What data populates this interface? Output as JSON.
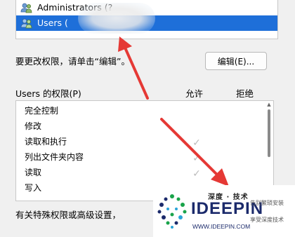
{
  "principals": [
    {
      "name": "Administrators (?",
      "selected": false
    },
    {
      "name": "Users (",
      "selected": true
    }
  ],
  "instruction": "要更改权限，请单击“编辑”。",
  "edit_button_label": "编辑(E)...",
  "permissions_header": {
    "title": "Users 的权限(P)",
    "allow": "允许",
    "deny": "拒绝"
  },
  "permissions": [
    {
      "label": "完全控制",
      "allow": false
    },
    {
      "label": "修改",
      "allow": false
    },
    {
      "label": "读取和执行",
      "allow": true
    },
    {
      "label": "列出文件夹内容",
      "allow": true
    },
    {
      "label": "读取",
      "allow": true
    },
    {
      "label": "写入",
      "allow": false
    }
  ],
  "special_text": "有关特殊权限或高级设置，",
  "watermark": {
    "top": "深度 · 技术",
    "brand": "IDEEPIN",
    "url": "WWW.IDEEPIN.COM",
    "side1": "告别繁琐安装",
    "side2": "享受深度技术"
  },
  "colors": {
    "selection": "#1e6fd9",
    "annotation_arrow": "#e53935",
    "check_mark": "#bcbcbc"
  },
  "icons": {
    "principal": "people-icon",
    "check": "check-icon",
    "scroll_up": "scroll-up-arrow-icon"
  }
}
